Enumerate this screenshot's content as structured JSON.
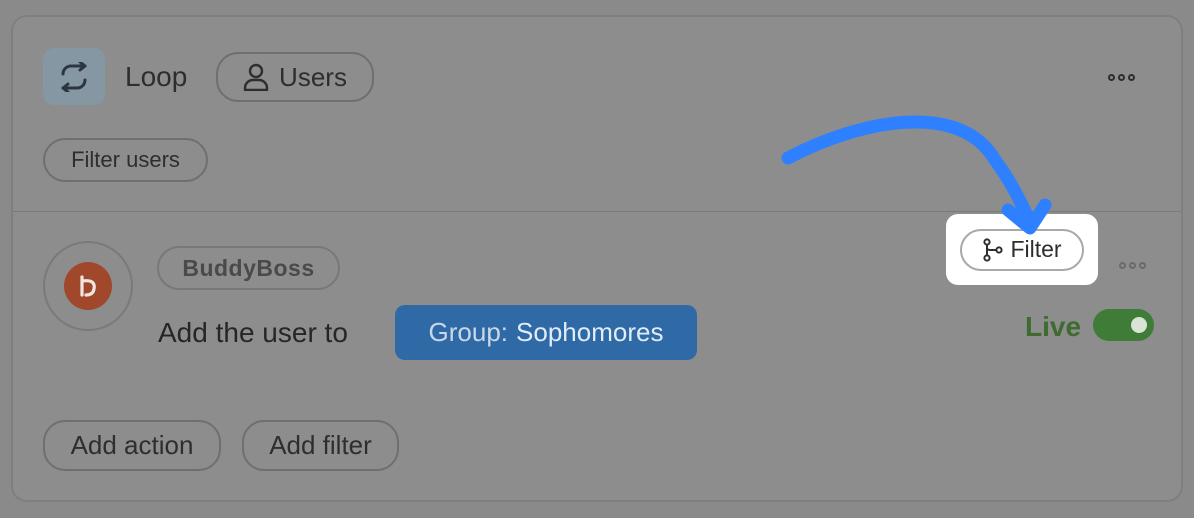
{
  "loop": {
    "title": "Loop",
    "users_label": "Users",
    "filter_users_label": "Filter users"
  },
  "action": {
    "integration_label": "BuddyBoss",
    "sentence": "Add the user to",
    "token_prefix": "Group:",
    "token_value": "Sophomores",
    "filter_label": "Filter",
    "status_label": "Live",
    "status_on": true
  },
  "footer": {
    "add_action_label": "Add action",
    "add_filter_label": "Add filter"
  },
  "colors": {
    "annotation_arrow": "#2f80ff",
    "live_green": "#3f7c38",
    "token_blue": "#2f6aa7"
  },
  "icons": {
    "loop": "loop-arrows-icon",
    "users": "user-icon",
    "filter": "branch-icon",
    "more": "more-dots-icon"
  }
}
